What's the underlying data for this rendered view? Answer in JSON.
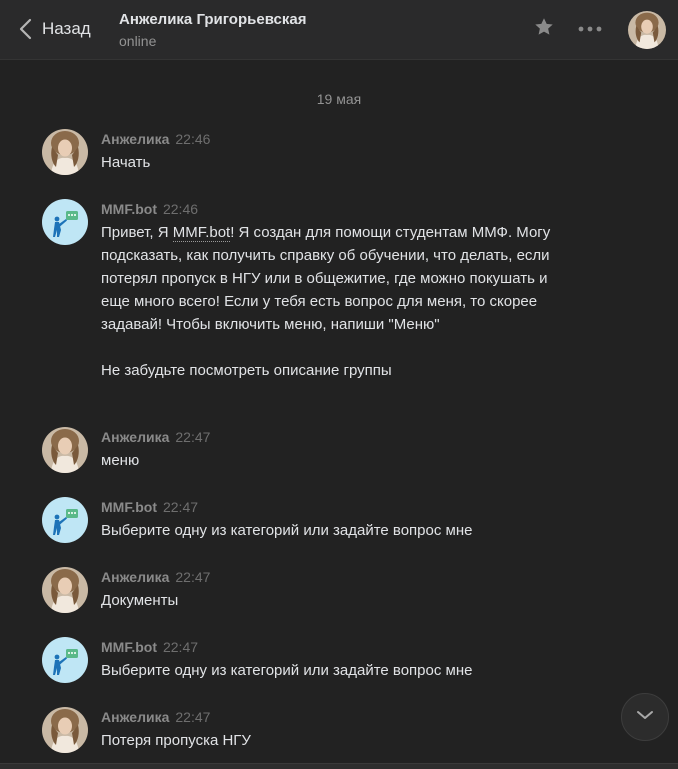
{
  "header": {
    "back_label": "Назад",
    "chat_name": "Анжелика Григорьевская",
    "status": "online"
  },
  "colors": {
    "background": "#222222",
    "header": "#2a2a2b",
    "text": "#e1e3e6",
    "muted": "#939393",
    "bot_avatar_bg": "#bfe6f5"
  },
  "date_separator": "19 мая",
  "messages": [
    {
      "author": "Анжелика",
      "time": "22:46",
      "avatar": "user-photo",
      "lines": [
        "Начать"
      ]
    },
    {
      "author": "MMF.bot",
      "time": "22:46",
      "avatar": "bot-logo",
      "lead_before_link": "Привет, Я ",
      "link_text": "MMF.bot",
      "lead_after_link": "! Я создан для помощи студентам ММФ. Могу подсказать, как получить справку об обучении, что делать, если потерял пропуск в НГУ или в общежитие, где можно покушать и еще много всего! Если у тебя есть вопрос для меня, то скорее задавай! Чтобы включить меню, напиши \"Меню\"",
      "footer": "Не забудьте посмотреть описание группы"
    },
    {
      "author": "Анжелика",
      "time": "22:47",
      "avatar": "user-photo",
      "lines": [
        "меню"
      ]
    },
    {
      "author": "MMF.bot",
      "time": "22:47",
      "avatar": "bot-logo",
      "lines": [
        "Выберите одну из категорий или задайте вопрос мне"
      ]
    },
    {
      "author": "Анжелика",
      "time": "22:47",
      "avatar": "user-photo",
      "lines": [
        "Документы"
      ]
    },
    {
      "author": "MMF.bot",
      "time": "22:47",
      "avatar": "bot-logo",
      "lines": [
        "Выберите одну из категорий или задайте вопрос мне"
      ]
    },
    {
      "author": "Анжелика",
      "time": "22:47",
      "avatar": "user-photo",
      "lines": [
        "Потеря пропуска НГУ"
      ]
    }
  ]
}
